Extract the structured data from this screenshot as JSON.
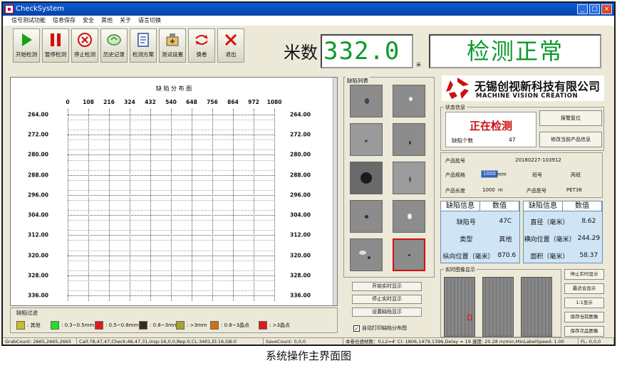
{
  "window": {
    "title": "CheckSystem"
  },
  "menu": [
    "信号测试功能",
    "信息保存",
    "安全",
    "其他",
    "关于",
    "语言切换"
  ],
  "toolbar": [
    {
      "label": "开始检测",
      "icon": "play-icon",
      "color": "#18a018"
    },
    {
      "label": "暂停检测",
      "icon": "pause-icon",
      "color": "#d01010"
    },
    {
      "label": "停止检测",
      "icon": "stop-icon",
      "color": "#d01010"
    },
    {
      "label": "历史记录",
      "icon": "history-icon",
      "color": "#3a8a3a"
    },
    {
      "label": "检测方案",
      "icon": "plan-icon",
      "color": "#2a4aa0"
    },
    {
      "label": "测试设置",
      "icon": "settings-icon",
      "color": "#3a3a3a"
    },
    {
      "label": "换卷",
      "icon": "change-roll-icon",
      "color": "#d01010"
    },
    {
      "label": "退出",
      "icon": "exit-icon",
      "color": "#d01010"
    }
  ],
  "meter": {
    "label": "米数",
    "value": "332.0",
    "unit": "米"
  },
  "status_display": "检测正常",
  "chart_data": {
    "type": "scatter",
    "title": "缺 陷 分 布 图",
    "x_ticks": [
      "0",
      "108",
      "216",
      "324",
      "432",
      "540",
      "648",
      "756",
      "864",
      "972",
      "1080"
    ],
    "y_ticks": [
      "264.00",
      "272.00",
      "280.00",
      "288.00",
      "296.00",
      "304.00",
      "312.00",
      "320.00",
      "328.00",
      "336.00"
    ],
    "xlim": [
      0,
      1080
    ],
    "ylim": [
      264,
      336
    ],
    "grid": true,
    "points": []
  },
  "legend": {
    "title": "缺陷过滤",
    "items": [
      {
        "label": ": 其他",
        "color": "#c8c020"
      },
      {
        "label": ": 0.3~0.5mm",
        "color": "#20e020"
      },
      {
        "label": ": 0.5~0.8mm",
        "color": "#e01818"
      },
      {
        "label": ": 0.8~3mm",
        "color": "#3a2a1a"
      },
      {
        "label": ": >3mm",
        "color": "#a8a030"
      },
      {
        "label": ": 0.8~3晶点",
        "color": "#d07010"
      },
      {
        "label": ": >3晶点",
        "color": "#e01818"
      }
    ]
  },
  "defect_list": {
    "title": "缺陷列表"
  },
  "defect_actions": [
    "开始实时显示",
    "停止实时显示",
    "设置缺陷显示"
  ],
  "auto_print": {
    "label": "自动打印缺陷分布图",
    "checked": true
  },
  "company": {
    "name_cn": "无锡创视新科技有限公司",
    "name_en": "MACHINE VISION CREATION"
  },
  "state": {
    "title": "状态信息",
    "text": "正在检测",
    "count_label": "缺陷个数",
    "count_value": "47",
    "reset_button": "报警复位",
    "modify_button": "修改当前产品信息"
  },
  "product": {
    "batch_label": "产品批号",
    "batch_value": "20180227-103912",
    "spec_label": "产品规格",
    "spec_value": "1000",
    "spec_unit": "mm",
    "shift_label": "班号",
    "shift_value": "丙班",
    "length_label": "产品长度",
    "length_value": "1000",
    "length_unit": "m",
    "model_label": "产品型号",
    "model_value": "PET38"
  },
  "defect_info_left": {
    "headers": [
      "缺陷信息",
      "数值"
    ],
    "rows": [
      [
        "缺陷号",
        "47C"
      ],
      [
        "类型",
        "其他"
      ],
      [
        "纵向位置（毫米）",
        "870.6"
      ]
    ]
  },
  "defect_info_right": {
    "headers": [
      "缺陷信息",
      "数值"
    ],
    "rows": [
      [
        "直径（毫米）",
        "8.62"
      ],
      [
        "横向位置（毫米）",
        "244.29"
      ],
      [
        "面积（毫米）",
        "58.37"
      ]
    ]
  },
  "realtime": {
    "title": "实时图像显示"
  },
  "realtime_buttons": [
    "停止实时显示",
    "最适合显示",
    "1:1显示",
    "保存当前图像",
    "保存次品图像"
  ],
  "statusbar": [
    "GrabCount: 2665,2665,2665",
    "Call:78,47,47,Check:46,47,31,Insp:16,0,0,Rep:0,CL:3401,El:16,GB:0",
    "SaveCount: 0,0,0",
    "本卷仓透帧数：0,L2=4' CI: 1806,1479,1396,Delay = 19 速度: 20.28 m/min,MinLabelSpeed: 1.00",
    "FL: 0,0,0"
  ],
  "caption": "系统操作主界面图"
}
